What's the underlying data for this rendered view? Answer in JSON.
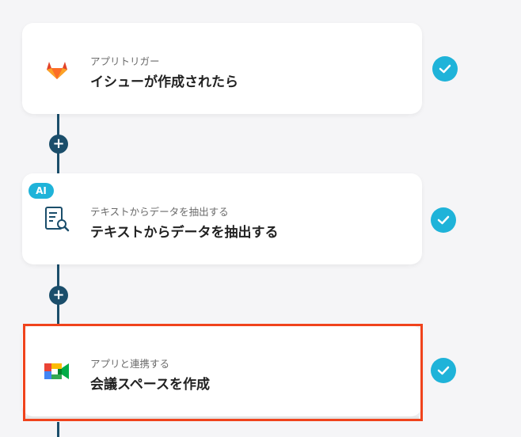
{
  "steps": [
    {
      "subtitle": "アプリトリガー",
      "title": "イシューが作成されたら",
      "icon": "gitlab-icon",
      "status": "complete"
    },
    {
      "subtitle": "テキストからデータを抽出する",
      "title": "テキストからデータを抽出する",
      "icon": "document-search-icon",
      "badge": "AI",
      "status": "complete"
    },
    {
      "subtitle": "アプリと連携する",
      "title": "会議スペースを作成",
      "icon": "google-meet-icon",
      "status": "complete",
      "highlighted": true
    }
  ],
  "add_button_label": "+",
  "colors": {
    "connector": "#1b4e6b",
    "check": "#1fb3d9",
    "highlight": "#f0431c",
    "ai_badge": "#1fb3d9"
  }
}
